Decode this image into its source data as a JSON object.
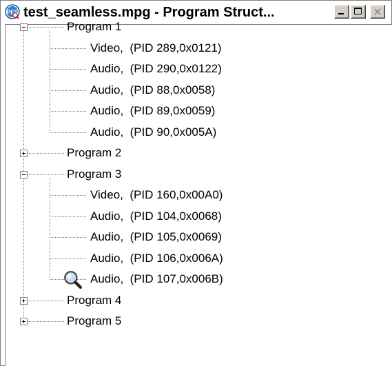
{
  "window": {
    "title": "test_seamless.mpg - Program Struct...",
    "app_icon": "pes-app-icon",
    "controls": [
      "minimize-button",
      "maximize-button",
      "close-button"
    ]
  },
  "tree": {
    "programs": [
      {
        "label": "Program 1",
        "expanded": true,
        "streams": [
          {
            "label": "Video,  (PID 289,0x0121)"
          },
          {
            "label": "Audio,  (PID 290,0x0122)"
          },
          {
            "label": "Audio,  (PID 88,0x0058)"
          },
          {
            "label": "Audio,  (PID 89,0x0059)"
          },
          {
            "label": "Audio,  (PID 90,0x005A)"
          }
        ]
      },
      {
        "label": "Program 2",
        "expanded": false,
        "streams": []
      },
      {
        "label": "Program 3",
        "expanded": true,
        "streams": [
          {
            "label": "Video,  (PID 160,0x00A0)"
          },
          {
            "label": "Audio,  (PID 104,0x0068)"
          },
          {
            "label": "Audio,  (PID 105,0x0069)"
          },
          {
            "label": "Audio,  (PID 106,0x006A)"
          },
          {
            "label": "Audio,  (PID 107,0x006B)",
            "icon": "magnifier-icon"
          }
        ]
      },
      {
        "label": "Program 4",
        "expanded": false,
        "streams": []
      },
      {
        "label": "Program 5",
        "expanded": false,
        "streams": []
      }
    ]
  }
}
